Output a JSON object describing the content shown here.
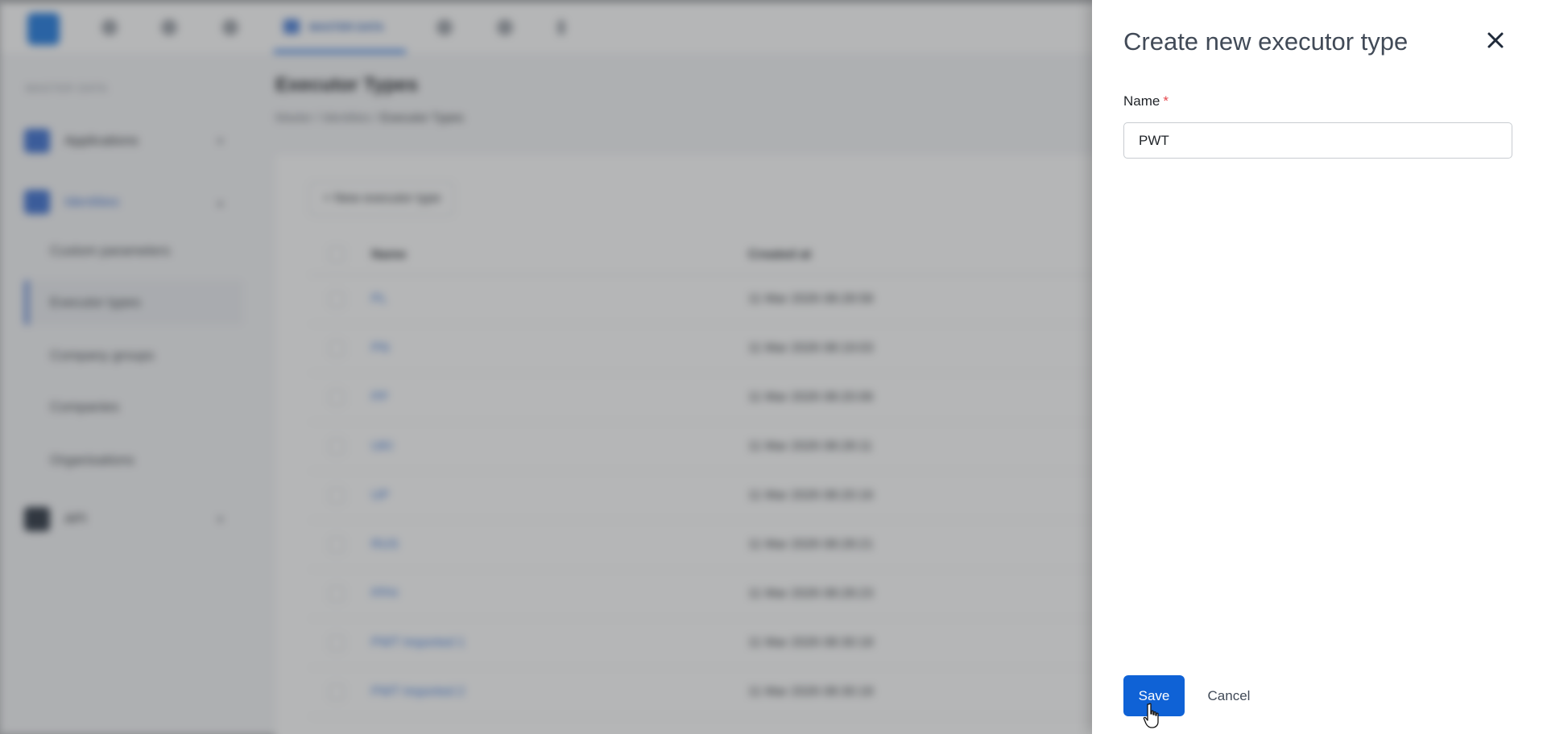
{
  "topnav": {
    "active_tab_label": "MASTER DATA"
  },
  "sidebar": {
    "section_label": "MASTER DATA",
    "items": [
      {
        "label": "Applications"
      },
      {
        "label": "Identities"
      },
      {
        "label": "API"
      }
    ],
    "sub_items": [
      {
        "label": "Custom parameters"
      },
      {
        "label": "Executor types"
      },
      {
        "label": "Company groups"
      },
      {
        "label": "Companies"
      },
      {
        "label": "Organisations"
      }
    ]
  },
  "page": {
    "title": "Executor Types",
    "breadcrumb": [
      "Master",
      "Identities",
      "Executor Types"
    ],
    "new_button_label": "+ New executor type"
  },
  "table": {
    "columns": [
      "Name",
      "Created at"
    ],
    "rows": [
      {
        "name": "PL",
        "created": "11 Mar 2026 08:28:58"
      },
      {
        "name": "PN",
        "created": "11 Mar 2026 08:19:03"
      },
      {
        "name": "PP",
        "created": "11 Mar 2026 08:20:06"
      },
      {
        "name": "UKI",
        "created": "11 Mar 2026 08:28:11"
      },
      {
        "name": "UP",
        "created": "11 Mar 2026 08:20:16"
      },
      {
        "name": "RUS",
        "created": "11 Mar 2026 08:28:21"
      },
      {
        "name": "PPH",
        "created": "11 Mar 2026 08:28:23"
      },
      {
        "name": "PWT Imported 1",
        "created": "11 Mar 2026 08:30:18"
      },
      {
        "name": "PWT Imported 2",
        "created": "11 Mar 2026 08:30:18"
      }
    ]
  },
  "drawer": {
    "title": "Create new executor type",
    "name_label": "Name",
    "required_mark": "*",
    "name_value": "PWT",
    "save_label": "Save",
    "cancel_label": "Cancel"
  },
  "colors": {
    "primary": "#0f62d6",
    "required": "#e5484d",
    "title_text": "#414a57"
  }
}
